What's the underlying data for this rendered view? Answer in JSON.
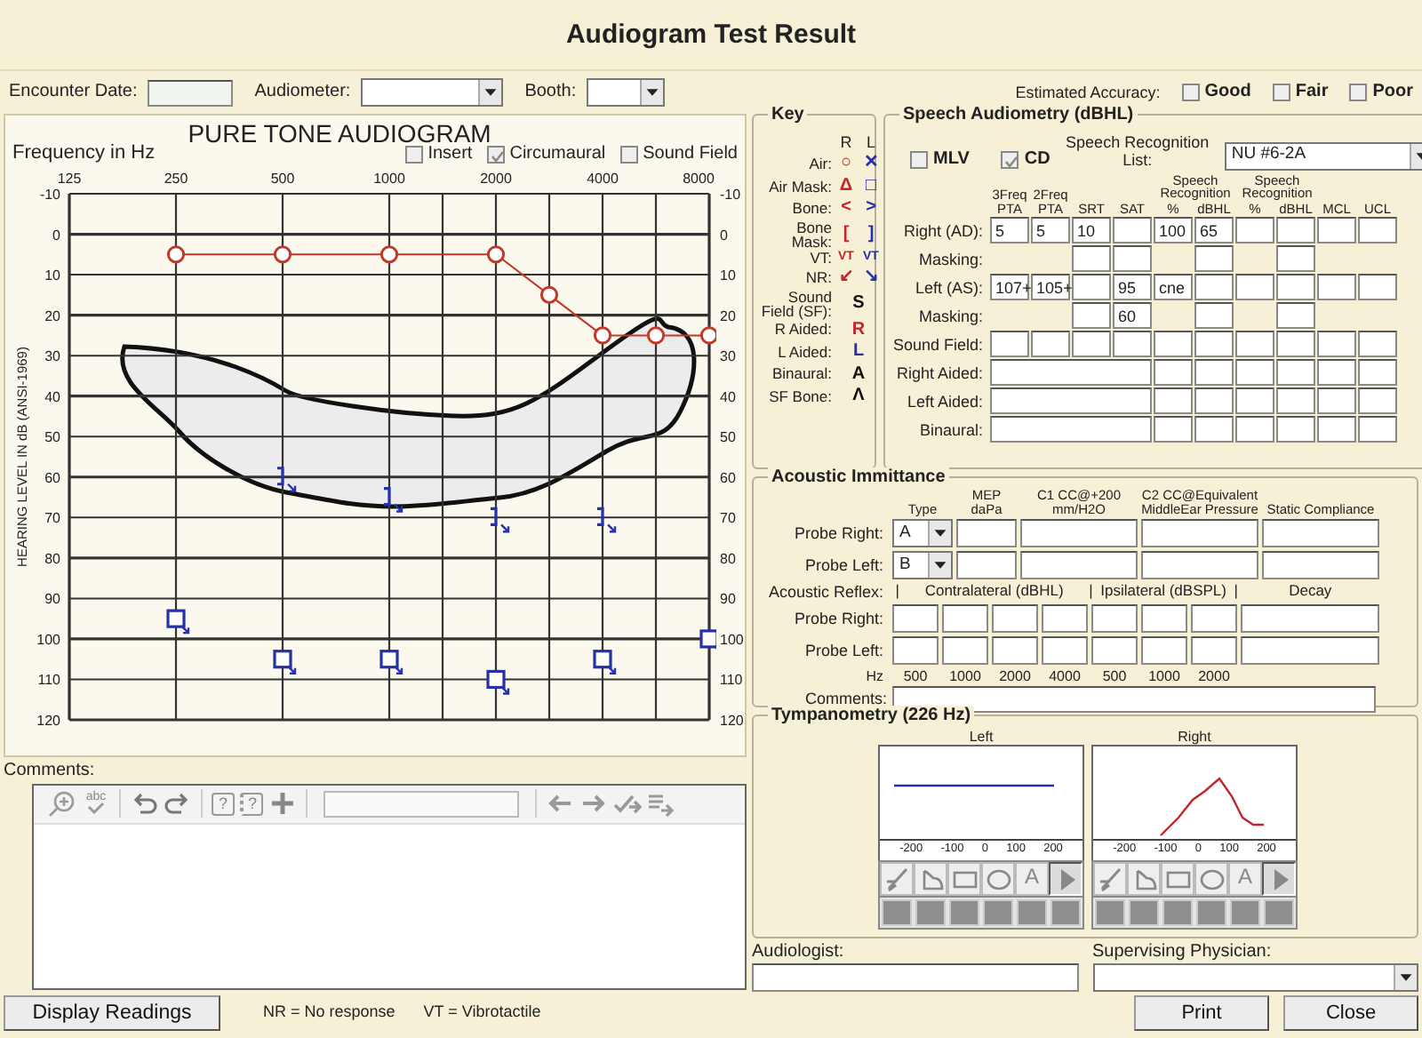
{
  "window": {
    "title": "Audiogram Test Result"
  },
  "header": {
    "encounter_date": {
      "label": "Encounter Date:"
    },
    "audiometer": {
      "label": "Audiometer:"
    },
    "booth": {
      "label": "Booth:"
    },
    "estimated_accuracy": {
      "label": "Estimated Accuracy:",
      "options": [
        {
          "label": "Good",
          "checked": false
        },
        {
          "label": "Fair",
          "checked": false
        },
        {
          "label": "Poor",
          "checked": false
        }
      ]
    }
  },
  "audiogram": {
    "title": "PURE TONE AUDIOGRAM",
    "options": [
      {
        "label": "Insert",
        "checked": false
      },
      {
        "label": "Circumaural",
        "checked": true
      },
      {
        "label": "Sound Field",
        "checked": false
      }
    ],
    "chart_data": {
      "type": "line",
      "xlabel": "Frequency in Hz",
      "ylabel": "HEARING LEVEL IN dB (ANSI-1969)",
      "grid": true,
      "categories": [
        "125",
        null,
        "250",
        null,
        "500",
        null,
        "1000",
        null,
        "2000",
        null,
        "4000",
        null,
        "8000"
      ],
      "ylim": [
        120,
        -10
      ],
      "yticks": [
        -10,
        0,
        10,
        20,
        30,
        40,
        50,
        60,
        70,
        80,
        90,
        100,
        110,
        120
      ],
      "series": [
        {
          "color": "#c0392b",
          "marker": "circle",
          "values": [
            null,
            null,
            5,
            null,
            5,
            null,
            5,
            null,
            5,
            15,
            25,
            25,
            25
          ]
        },
        {
          "color": "#2630a8",
          "type": "scatter",
          "values": [
            null,
            null,
            null,
            null,
            60,
            null,
            65,
            null,
            70,
            null,
            70,
            null,
            null
          ]
        },
        {
          "color": "#2630a8",
          "type": "scatter",
          "marker": "square",
          "values": [
            null,
            null,
            95,
            null,
            105,
            null,
            105,
            null,
            110,
            null,
            105,
            null,
            100
          ]
        }
      ]
    },
    "right_axis": {
      "labels": [
        "-10",
        "0",
        "10",
        "20",
        "30",
        "40",
        "50",
        "60",
        "70",
        "80",
        "90",
        "100",
        "110",
        "120"
      ]
    }
  },
  "comments": {
    "label": "Comments:",
    "toolbar": [
      {
        "kind": "zoom"
      },
      {
        "kind": "spellcheck",
        "label": "abc"
      },
      {
        "kind": "sep"
      },
      {
        "kind": "undo"
      },
      {
        "kind": "redo"
      },
      {
        "kind": "sep"
      },
      {
        "kind": "help",
        "label": "?"
      },
      {
        "kind": "help-down",
        "label": "?"
      },
      {
        "kind": "plus"
      },
      {
        "kind": "sep"
      },
      {
        "kind": "field"
      },
      {
        "kind": "sep"
      },
      {
        "kind": "left"
      },
      {
        "kind": "right"
      },
      {
        "kind": "check-arrow"
      },
      {
        "kind": "list-arrow"
      }
    ]
  },
  "footer": {
    "button": "Display Readings",
    "notes": [
      "NR = No response",
      "VT = Vibrotactile"
    ]
  },
  "key": {
    "title": "Key",
    "columns": [
      "R",
      "L"
    ],
    "rows": [
      {
        "label": "Air:",
        "r": "○",
        "l": "✕"
      },
      {
        "label": "Air Mask:",
        "r": "Δ",
        "l": "□"
      },
      {
        "label": "Bone:",
        "r": "<",
        "l": ">"
      },
      {
        "label": "Bone Mask:",
        "r": "[",
        "l": "]"
      },
      {
        "label": "VT:",
        "r": "VT",
        "l": "VT"
      },
      {
        "label": "NR:",
        "r": "↙",
        "l": "↘"
      },
      {
        "label": "Sound Field (SF):",
        "symbol": "S",
        "color": "#111111"
      },
      {
        "label": "R Aided:",
        "symbol": "R",
        "color": "#c0262b"
      },
      {
        "label": "L Aided:",
        "symbol": "L",
        "color": "#2630a8"
      },
      {
        "label": "Binaural:",
        "symbol": "A",
        "color": "#111111"
      },
      {
        "label": "SF Bone:",
        "symbol": "Λ",
        "color": "#111111"
      }
    ]
  },
  "speech": {
    "title": "Speech Audiometry (dBHL)",
    "options": [
      {
        "label": "MLV",
        "checked": false
      },
      {
        "label": "CD",
        "checked": true
      }
    ],
    "list": {
      "label": "Speech Recognition List:",
      "value": "NU #6-2A"
    },
    "columns": [
      {
        "label": "3Freq PTA"
      },
      {
        "label": "2Freq PTA"
      },
      {
        "label": "SRT"
      },
      {
        "label": "SAT"
      },
      {
        "group": "Speech Recognition",
        "label": "%"
      },
      {
        "label": "dBHL"
      },
      {
        "group": "Speech Recognition",
        "label": "%"
      },
      {
        "label": "dBHL"
      },
      {
        "label": "MCL"
      },
      {
        "label": "UCL"
      }
    ],
    "rows": [
      {
        "label": "Right (AD):",
        "fields": [
          {
            "kind": "field",
            "value": "5"
          },
          {
            "kind": "field",
            "value": "5"
          },
          {
            "kind": "field",
            "value": "10"
          },
          {
            "kind": "field"
          },
          {
            "kind": "field",
            "value": "100"
          },
          {
            "kind": "field",
            "value": "65"
          },
          {
            "kind": "field"
          },
          {
            "kind": "field"
          },
          {
            "kind": "field"
          },
          {
            "kind": "field"
          }
        ]
      },
      {
        "label": "Masking:",
        "fields": [
          {
            "kind": "gap"
          },
          {
            "kind": "gap"
          },
          {
            "kind": "field"
          },
          {
            "kind": "field"
          },
          {
            "kind": "gap"
          },
          {
            "kind": "field"
          },
          {
            "kind": "gap"
          },
          {
            "kind": "field"
          },
          {
            "kind": "gap"
          },
          {
            "kind": "gap"
          }
        ]
      },
      {
        "label": "Left (AS):",
        "fields": [
          {
            "kind": "field",
            "value": "107+"
          },
          {
            "kind": "field",
            "value": "105+"
          },
          {
            "kind": "field"
          },
          {
            "kind": "field",
            "value": "95"
          },
          {
            "kind": "field",
            "value": "cne"
          },
          {
            "kind": "field"
          },
          {
            "kind": "field"
          },
          {
            "kind": "field"
          },
          {
            "kind": "field"
          },
          {
            "kind": "field"
          }
        ]
      },
      {
        "label": "Masking:",
        "fields": [
          {
            "kind": "gap"
          },
          {
            "kind": "gap"
          },
          {
            "kind": "field"
          },
          {
            "kind": "field",
            "value": "60"
          },
          {
            "kind": "gap"
          },
          {
            "kind": "field"
          },
          {
            "kind": "gap"
          },
          {
            "kind": "field"
          },
          {
            "kind": "gap"
          },
          {
            "kind": "gap"
          }
        ]
      },
      {
        "label": "Sound Field:",
        "fields": [
          {
            "kind": "field"
          },
          {
            "kind": "field"
          },
          {
            "kind": "field"
          },
          {
            "kind": "field"
          },
          {
            "kind": "field"
          },
          {
            "kind": "field"
          },
          {
            "kind": "field"
          },
          {
            "kind": "field"
          },
          {
            "kind": "field"
          },
          {
            "kind": "field"
          }
        ]
      },
      {
        "label": "Right Aided:",
        "fields": [
          {
            "kind": "wide"
          },
          {
            "kind": "field"
          },
          {
            "kind": "field"
          },
          {
            "kind": "field"
          },
          {
            "kind": "field"
          },
          {
            "kind": "field"
          },
          {
            "kind": "field"
          }
        ]
      },
      {
        "label": "Left Aided:",
        "fields": [
          {
            "kind": "wide"
          },
          {
            "kind": "field"
          },
          {
            "kind": "field"
          },
          {
            "kind": "field"
          },
          {
            "kind": "field"
          },
          {
            "kind": "field"
          },
          {
            "kind": "field"
          }
        ]
      },
      {
        "label": "Binaural:",
        "fields": [
          {
            "kind": "wide"
          },
          {
            "kind": "field"
          },
          {
            "kind": "field"
          },
          {
            "kind": "field"
          },
          {
            "kind": "field"
          },
          {
            "kind": "field"
          },
          {
            "kind": "field"
          }
        ]
      }
    ]
  },
  "immittance": {
    "title": "Acoustic Immittance",
    "columns": [
      "Type",
      "MEP daPa",
      "C1 CC@+200 mm/H2O",
      "C2 CC@Equivalent MiddleEar Pressure",
      "Static Compliance"
    ],
    "probes": [
      {
        "label": "Probe Right:",
        "type": "A"
      },
      {
        "label": "Probe Left:",
        "type": "B"
      }
    ],
    "reflex": {
      "label": "Acoustic Reflex:",
      "headers": [
        {
          "kind": "divider",
          "text": "|"
        },
        {
          "kind": "contralateral",
          "text": "Contralateral (dBHL)"
        },
        {
          "kind": "divider",
          "text": "|"
        },
        {
          "kind": "ipsilateral",
          "text": "Ipsilateral (dBSPL)"
        },
        {
          "kind": "divider",
          "text": "|"
        },
        {
          "kind": "decay",
          "text": "Decay"
        }
      ],
      "rows": [
        {
          "label": "Probe Right:"
        },
        {
          "label": "Probe Left:"
        }
      ],
      "hz": [
        "Hz",
        "500",
        "1000",
        "2000",
        "4000",
        "500",
        "1000",
        "2000"
      ]
    },
    "comments": {
      "label": "Comments:"
    }
  },
  "tympanometry": {
    "title": "Tympanometry (226 Hz)",
    "panels": [
      {
        "label": "Left",
        "kind": "flat",
        "ticks": [
          "-200",
          "-100",
          "0",
          "100",
          "200"
        ],
        "tools": [
          {
            "kind": "pen",
            "selected": false
          },
          {
            "kind": "lasso",
            "selected": false
          },
          {
            "kind": "rect",
            "selected": false
          },
          {
            "kind": "ellipse",
            "selected": false
          },
          {
            "kind": "text",
            "label": "A",
            "selected": false
          },
          {
            "kind": "pointer",
            "selected": true
          }
        ]
      },
      {
        "label": "Right",
        "kind": "peak",
        "ticks": [
          "-200",
          "-100",
          "0",
          "100",
          "200"
        ],
        "tools": [
          {
            "kind": "pen",
            "selected": false
          },
          {
            "kind": "lasso",
            "selected": false
          },
          {
            "kind": "rect",
            "selected": false
          },
          {
            "kind": "ellipse",
            "selected": false
          },
          {
            "kind": "text",
            "label": "A",
            "selected": false
          },
          {
            "kind": "pointer",
            "selected": true
          }
        ]
      }
    ]
  },
  "signatures": [
    {
      "label": "Audiologist:",
      "kind": "field"
    },
    {
      "label": "Supervising Physician:",
      "kind": "dropdown"
    }
  ],
  "buttons": [
    "Print",
    "Close"
  ]
}
